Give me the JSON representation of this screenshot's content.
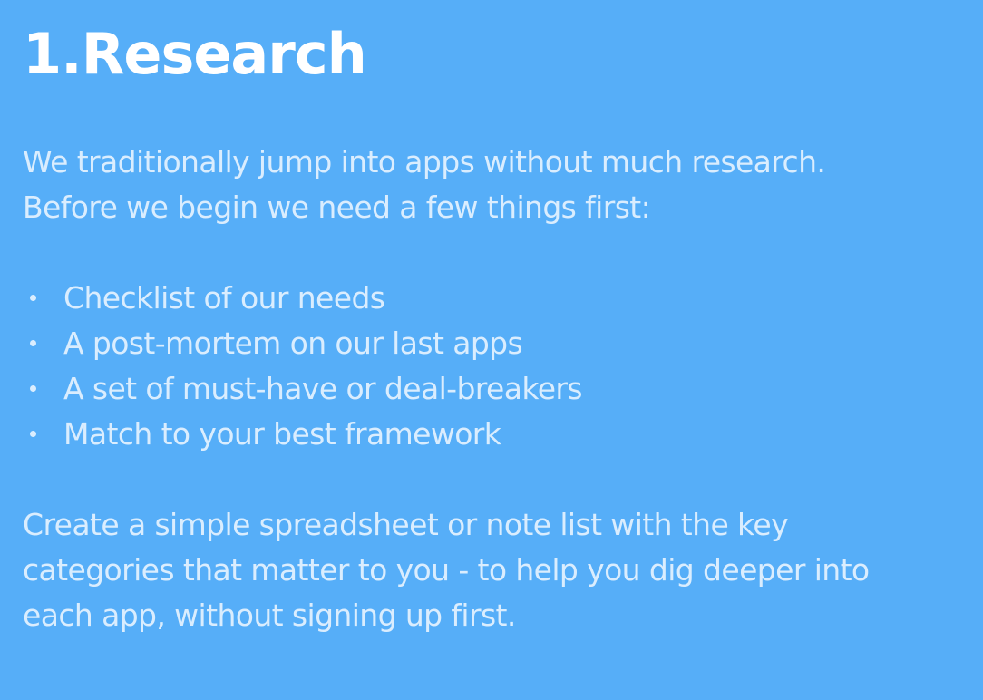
{
  "slide": {
    "title": "1.Research",
    "intro_lines": [
      "We traditionally jump into apps without much research.",
      "Before we begin we need a few things first:"
    ],
    "bullets": [
      "Checklist of our needs",
      "A post-mortem on our last apps",
      "A set of must-have or deal-breakers",
      "Match to your best framework"
    ],
    "outro_lines": [
      "Create a simple spreadsheet or note list with the key",
      "categories that matter to you - to help you dig deeper into",
      "each app, without signing up first."
    ]
  },
  "colors": {
    "background": "#56aef8",
    "text": "#ffffff"
  }
}
